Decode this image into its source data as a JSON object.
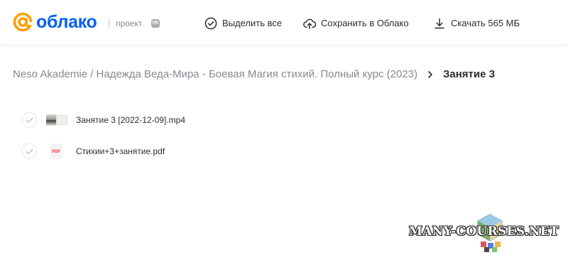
{
  "header": {
    "logo_text": "облако",
    "project_label": "проект",
    "project_badge": "VK",
    "select_all_label": "Выделить все",
    "save_label": "Сохранить в Облако",
    "download_label": "Скачать 565 МБ"
  },
  "breadcrumb": {
    "parent": "Neso Akademie / Надежда Веда-Мира - Боевая Магия стихий. Полный курс (2023)",
    "current": "Занятие 3"
  },
  "files": [
    {
      "name": "Занятие 3 [2022-12-09].mp4",
      "type": "video",
      "selected": false
    },
    {
      "name": "Стихии+3+занятие.pdf",
      "type": "pdf",
      "type_label": "PDF",
      "selected": false
    }
  ],
  "watermark": {
    "text": "MANY-COURSES.NET"
  },
  "colors": {
    "logo_orange": "#ff9e00",
    "brand_blue": "#005ff9",
    "text_primary": "#2c2d2e",
    "text_secondary": "#87898f",
    "pdf_red": "#ff3347"
  },
  "icons": {
    "select_all": "check-circle-icon",
    "save": "cloud-upload-icon",
    "download": "download-icon",
    "breadcrumb_separator": "chevron-right-icon",
    "row_select": "check-icon"
  }
}
